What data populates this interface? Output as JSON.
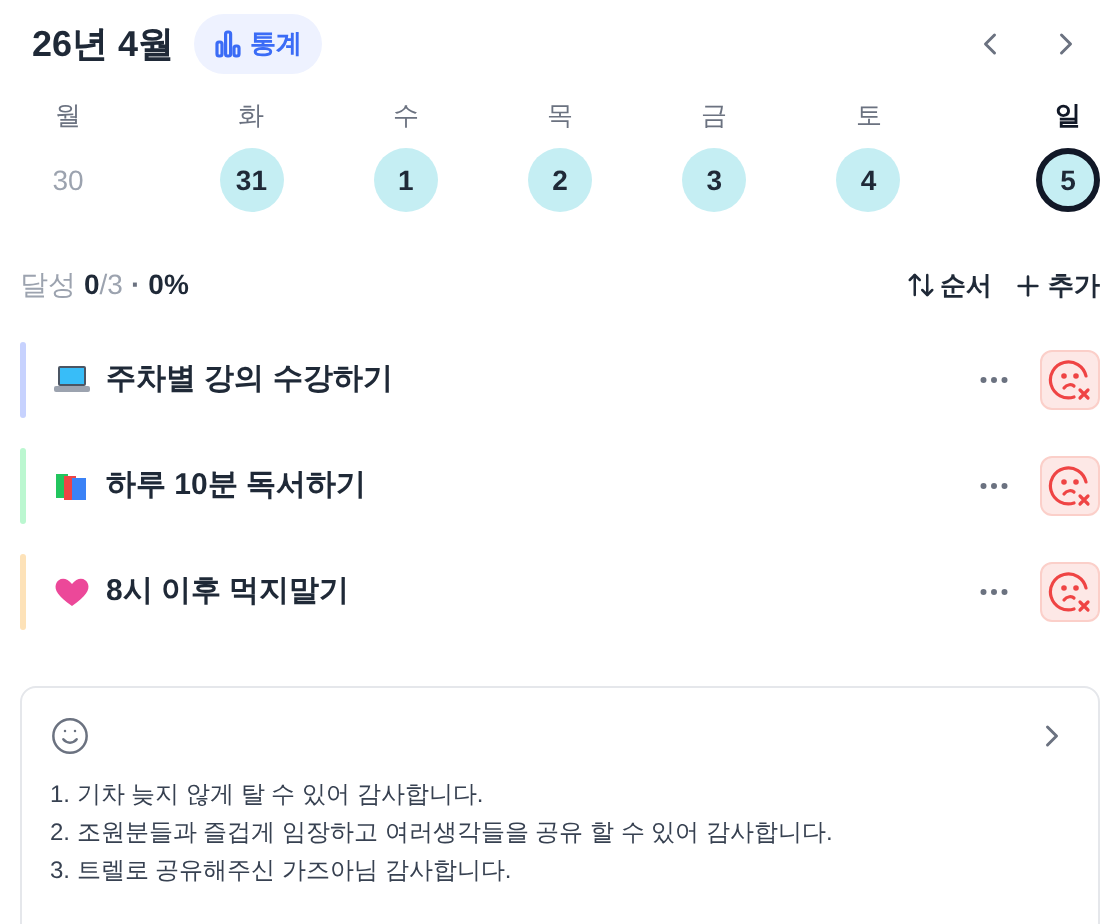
{
  "header": {
    "title": "26년 4월",
    "stats_button": "통계"
  },
  "week": [
    {
      "weekday": "월",
      "date": "30",
      "filled": false,
      "selected": false
    },
    {
      "weekday": "화",
      "date": "31",
      "filled": true,
      "selected": false
    },
    {
      "weekday": "수",
      "date": "1",
      "filled": true,
      "selected": false
    },
    {
      "weekday": "목",
      "date": "2",
      "filled": true,
      "selected": false
    },
    {
      "weekday": "금",
      "date": "3",
      "filled": true,
      "selected": false
    },
    {
      "weekday": "토",
      "date": "4",
      "filled": true,
      "selected": false
    },
    {
      "weekday": "일",
      "date": "5",
      "filled": true,
      "selected": true
    }
  ],
  "summary": {
    "label": "달성",
    "done": "0",
    "total": "/3",
    "separator": "·",
    "percent": "0%",
    "sort_button": "순서",
    "add_button": "추가"
  },
  "habits": [
    {
      "kind": "laptop",
      "title": "주차별 강의 수강하기",
      "color": "#c7d2fe"
    },
    {
      "kind": "books",
      "title": "하루 10분 독서하기",
      "color": "#bbf7d0"
    },
    {
      "kind": "heart",
      "title": "8시 이후 먹지말기",
      "color": "#fde2b8"
    }
  ],
  "gratitude": {
    "lines": [
      "1. 기차 늦지 않게 탈 수 있어 감사합니다.",
      "2. 조원분들과 즐겁게 임장하고 여러생각들을 공유 할 수 있어 감사합니다.",
      "3. 트렐로 공유해주신 가즈아님 감사합니다."
    ]
  }
}
